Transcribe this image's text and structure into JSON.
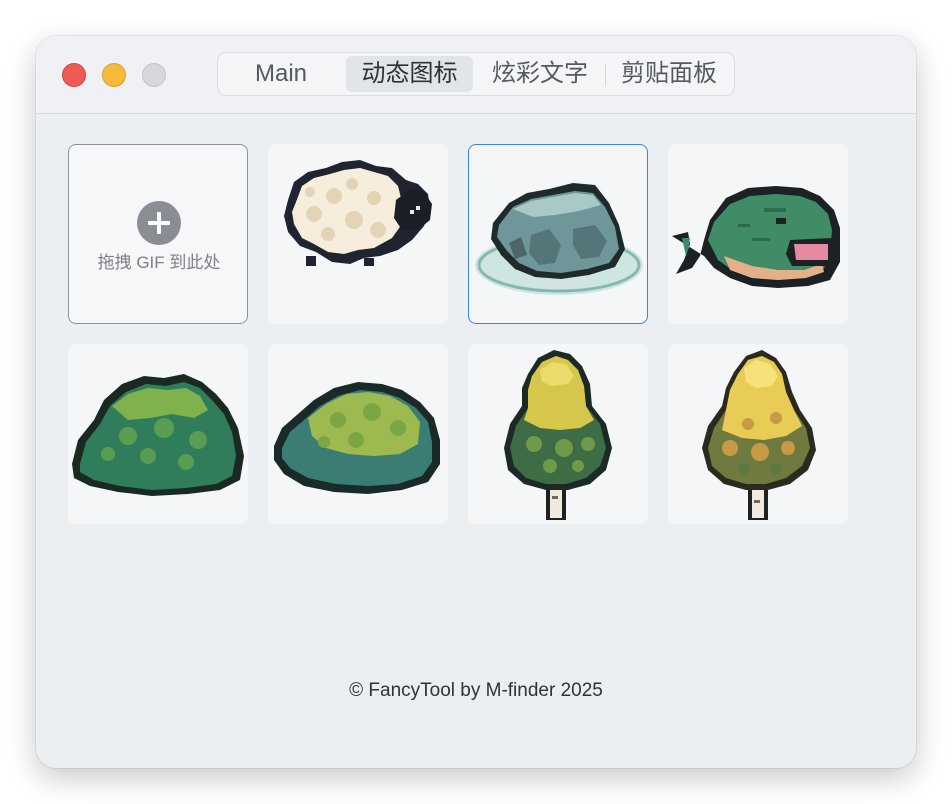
{
  "window": {
    "traffic_lights": [
      "close",
      "minimize",
      "zoom"
    ]
  },
  "tabs": [
    {
      "label": "Main",
      "active": false
    },
    {
      "label": "动态图标",
      "active": true
    },
    {
      "label": "炫彩文字",
      "active": false
    },
    {
      "label": "剪贴面板",
      "active": false
    }
  ],
  "grid": {
    "drop_zone": {
      "label": "拖拽 GIF 到此处",
      "icon": "plus-icon"
    },
    "items": [
      {
        "name": "sheep",
        "selected": false
      },
      {
        "name": "rock",
        "selected": true
      },
      {
        "name": "whale",
        "selected": false
      },
      {
        "name": "bush-dark",
        "selected": false
      },
      {
        "name": "bush-light",
        "selected": false
      },
      {
        "name": "tree-green",
        "selected": false
      },
      {
        "name": "tree-yellow",
        "selected": false
      }
    ]
  },
  "footer": {
    "text": "© FancyTool by M-finder 2025"
  },
  "colors": {
    "accent": "#3b82f6",
    "window_bg": "#eceff1",
    "tile_bg": "#f5f6f7"
  }
}
